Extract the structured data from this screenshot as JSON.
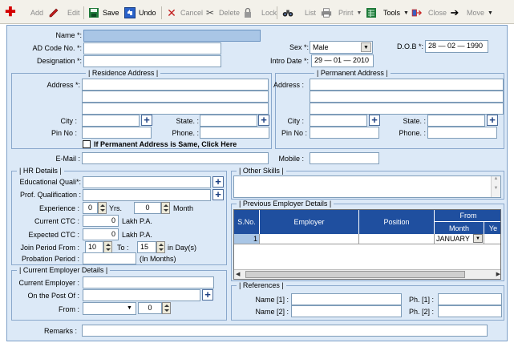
{
  "toolbar": {
    "add": "Add",
    "edit": "Edit",
    "save": "Save",
    "undo": "Undo",
    "cancel": "Cancel",
    "delete": "Delete",
    "lock": "Lock",
    "list": "List",
    "print": "Print",
    "tools": "Tools",
    "close": "Close",
    "move": "Move"
  },
  "form": {
    "name_label": "Name *:",
    "ad_code_label": "AD Code No. *:",
    "designation_label": "Designation *:",
    "sex_label": "Sex *:",
    "sex_value": "Male",
    "dob_label": "D.O.B *:",
    "dob_value": "28 — 02 — 1990",
    "intro_date_label": "Intro Date *:",
    "intro_date_value": "29 — 01 — 2010",
    "email_label": "E-Mail :",
    "mobile_label": "Mobile :",
    "remarks_label": "Remarks :"
  },
  "residence": {
    "title": "Residence Address",
    "address_label": "Address *:",
    "city_label": "City :",
    "state_label": "State. :",
    "pin_label": "Pin No :",
    "phone_label": "Phone. :",
    "same_address_checkbox": "If Permanent Address is Same, Click Here"
  },
  "permanent": {
    "title": "Permanent Address",
    "address_label": "Address :",
    "city_label": "City :",
    "state_label": "State. :",
    "pin_label": "Pin No :",
    "phone_label": "Phone. :"
  },
  "hr": {
    "title": "HR Details",
    "edu_label": "Educational Quali*:",
    "prof_label": "Prof. Qualification :",
    "experience_label": "Experience :",
    "exp_years_value": "0",
    "yrs_label": "Yrs.",
    "exp_months_value": "0",
    "month_label": "Month",
    "current_ctc_label": "Current CTC :",
    "current_ctc_value": "0",
    "expected_ctc_label": "Expected CTC :",
    "expected_ctc_value": "0",
    "lakh_label": "Lakh P.A.",
    "join_period_label": "Join Period From :",
    "join_from_value": "10",
    "to_label": "To :",
    "join_to_value": "15",
    "in_days_label": "in Day(s)",
    "probation_label": "Probation Period :",
    "in_months_label": "(In Months)"
  },
  "current_employer": {
    "title": "Current Employer Details",
    "employer_label": "Current Employer :",
    "post_label": "On the Post Of :",
    "from_label": "From :",
    "from_year_value": "0"
  },
  "other_skills": {
    "title": "Other Skills"
  },
  "previous_employer": {
    "title": "Previous Employer Details",
    "columns": [
      "S.No.",
      "Employer",
      "Position",
      "From"
    ],
    "sub_columns": [
      "Month",
      "Ye"
    ],
    "rows": [
      {
        "sno": "1",
        "employer": "",
        "position": "",
        "month": "JANUARY"
      }
    ]
  },
  "references": {
    "title": "References",
    "name1_label": "Name [1] :",
    "name2_label": "Name [2] :",
    "ph1_label": "Ph. [1] :",
    "ph2_label": "Ph. [2] :"
  },
  "icons": {
    "add": "plus-icon",
    "edit": "pencil-icon",
    "save": "floppy-icon",
    "undo": "undo-icon",
    "cancel": "x-icon",
    "delete": "scissors-icon",
    "lock": "lock-icon",
    "list": "binoculars-icon",
    "print": "printer-icon",
    "tools": "spreadsheet-icon",
    "close": "exit-icon",
    "move": "arrow-right-icon"
  },
  "colors": {
    "panel_bg": "#dce9f7",
    "readonly_field": "#a9c6e6",
    "grid_header": "#1f4f9f",
    "add_red": "#d40000"
  }
}
